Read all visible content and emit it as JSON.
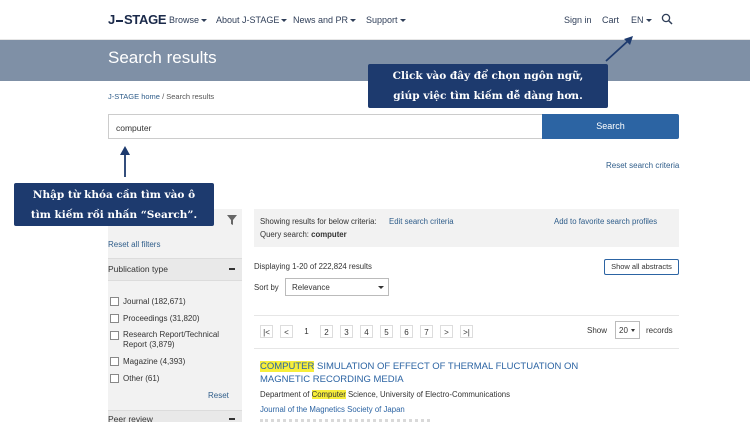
{
  "header": {
    "logo": {
      "left": "J",
      "right": "STAGE"
    },
    "nav": [
      {
        "label": "Browse",
        "has_caret": true
      },
      {
        "label": "About J-STAGE",
        "has_caret": true
      },
      {
        "label": "News and PR",
        "has_caret": true
      },
      {
        "label": "Support",
        "has_caret": true
      }
    ],
    "right": {
      "signin": "Sign in",
      "cart": "Cart",
      "lang": "EN"
    }
  },
  "banner": {
    "title": "Search results"
  },
  "breadcrumb": {
    "home": "J-STAGE home",
    "sep": "/",
    "current": "Search results"
  },
  "search": {
    "value": "computer",
    "button": "Search",
    "reset": "Reset search criteria"
  },
  "annotations": {
    "language_tip": [
      "Click vào đây để chọn ngôn ngữ,",
      "giúp việc tìm kiếm dễ dàng hơn."
    ],
    "search_tip": [
      "Nhập từ khóa cần tìm vào ô",
      "tìm kiếm rồi nhấn “Search”."
    ]
  },
  "sidebar": {
    "reset_all": "Reset all filters",
    "publication_type": {
      "label": "Publication type",
      "options": [
        {
          "label": "Journal (182,671)"
        },
        {
          "label": "Proceedings (31,820)"
        },
        {
          "label": "Research Report/Technical",
          "label2": "Report (3,879)"
        },
        {
          "label": "Magazine (4,393)"
        },
        {
          "label": "Other (61)"
        }
      ],
      "reset": "Reset"
    },
    "peer_review": {
      "label": "Peer review"
    }
  },
  "criteria": {
    "showing": "Showing results for below criteria:",
    "edit": "Edit search criteria",
    "favorite": "Add to favorite search profiles",
    "query_label": "Query search:",
    "query_value": "computer"
  },
  "results": {
    "displaying": "Displaying 1-20 of 222,824 results",
    "show_all": "Show all abstracts",
    "sort_label": "Sort by",
    "sort_value": "Relevance",
    "pagination": {
      "first": "|<",
      "prev": "<",
      "pages": [
        "1",
        "2",
        "3",
        "4",
        "5",
        "6",
        "7"
      ],
      "next": ">",
      "last": ">|",
      "show_label": "Show",
      "per_page": "20",
      "records_label": "records"
    },
    "items": [
      {
        "title_highlight": "COMPUTER",
        "title_rest": " SIMULATION OF EFFECT OF THERMAL FLUCTUATION ON",
        "title_line2": "MAGNETIC RECORDING MEDIA",
        "affil_pre": "Department of ",
        "affil_highlight": "Computer",
        "affil_post": " Science, University of Electro-Communications",
        "journal": "Journal of the Magnetics Society of Japan"
      }
    ]
  },
  "colors": {
    "banner": "#7f90a6",
    "link": "#2c64a3",
    "search_button": "#2c64a3",
    "callout": "#1d3a6e",
    "highlight": "#f7ee3a"
  }
}
